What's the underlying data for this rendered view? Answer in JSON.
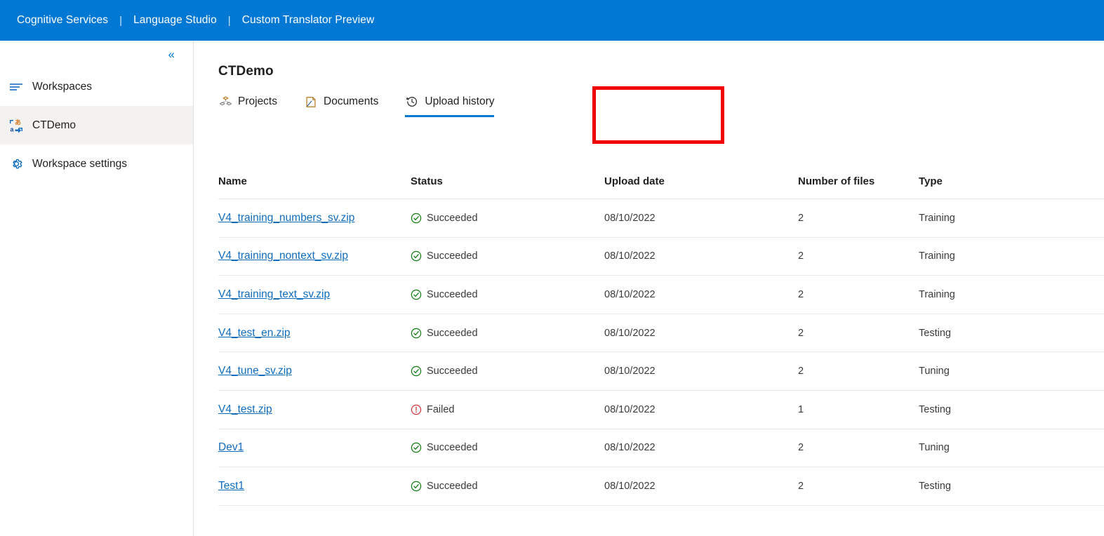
{
  "header": {
    "items": [
      {
        "label": "Cognitive Services"
      },
      {
        "label": "Language Studio"
      },
      {
        "label": "Custom Translator Preview"
      }
    ],
    "separator": "|",
    "background_color": "#0078d4"
  },
  "sidebar": {
    "collapse_icon": "chevron-double-left-icon",
    "items": [
      {
        "label": "Workspaces",
        "icon": "list-icon",
        "selected": false
      },
      {
        "label": "CTDemo",
        "icon": "translator-icon",
        "selected": true
      },
      {
        "label": "Workspace settings",
        "icon": "gear-icon",
        "selected": false
      }
    ]
  },
  "main": {
    "title": "CTDemo",
    "tabs": [
      {
        "label": "Projects",
        "icon": "projects-icon",
        "active": false
      },
      {
        "label": "Documents",
        "icon": "document-icon",
        "active": false
      },
      {
        "label": "Upload history",
        "icon": "history-clock-icon",
        "active": true
      }
    ],
    "annotation": {
      "color": "#ee0000",
      "target": "Upload history"
    },
    "table": {
      "columns": [
        "Name",
        "Status",
        "Upload date",
        "Number of files",
        "Type"
      ],
      "rows": [
        {
          "name": "V4_training_numbers_sv.zip",
          "status": "Succeeded",
          "status_type": "success",
          "upload_date": "08/10/2022",
          "number_of_files": "2",
          "type": "Training"
        },
        {
          "name": "V4_training_nontext_sv.zip",
          "status": "Succeeded",
          "status_type": "success",
          "upload_date": "08/10/2022",
          "number_of_files": "2",
          "type": "Training"
        },
        {
          "name": "V4_training_text_sv.zip",
          "status": "Succeeded",
          "status_type": "success",
          "upload_date": "08/10/2022",
          "number_of_files": "2",
          "type": "Training"
        },
        {
          "name": "V4_test_en.zip",
          "status": "Succeeded",
          "status_type": "success",
          "upload_date": "08/10/2022",
          "number_of_files": "2",
          "type": "Testing"
        },
        {
          "name": "V4_tune_sv.zip",
          "status": "Succeeded",
          "status_type": "success",
          "upload_date": "08/10/2022",
          "number_of_files": "2",
          "type": "Tuning"
        },
        {
          "name": "V4_test.zip",
          "status": "Failed",
          "status_type": "error",
          "upload_date": "08/10/2022",
          "number_of_files": "1",
          "type": "Testing"
        },
        {
          "name": "Dev1",
          "status": "Succeeded",
          "status_type": "success",
          "upload_date": "08/10/2022",
          "number_of_files": "2",
          "type": "Tuning"
        },
        {
          "name": "Test1",
          "status": "Succeeded",
          "status_type": "success",
          "upload_date": "08/10/2022",
          "number_of_files": "2",
          "type": "Testing"
        }
      ]
    }
  },
  "colors": {
    "accent": "#0078d4",
    "link": "#0f6cbd",
    "success": "#107c10",
    "error": "#d13438",
    "annotation": "#ee0000",
    "selected_row": "#f3f2f1"
  }
}
